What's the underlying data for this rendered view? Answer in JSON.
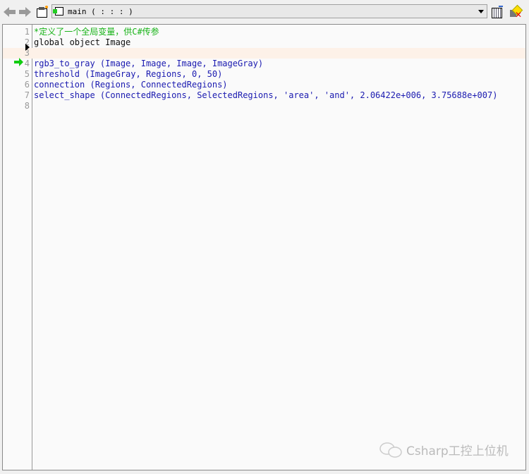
{
  "toolbar": {
    "icons": [
      "back-arrow-icon",
      "forward-arrow-icon",
      "procedure-clipboard-icon",
      "procedure-calendar-icon",
      "delete-procedure-icon"
    ],
    "procedure_select": {
      "value": "main ( : : : )"
    }
  },
  "editor": {
    "lines": [
      {
        "number": "1",
        "text": "*定义了一个全局变量，供C#传参",
        "color": "#18b318"
      },
      {
        "number": "2",
        "text": "global object Image",
        "color": "#111111"
      },
      {
        "number": "3",
        "text": "",
        "highlighted": true
      },
      {
        "number": "4",
        "text": "rgb3_to_gray (Image, Image, Image, ImageGray)",
        "color": "#1a1ab0",
        "program_counter": true
      },
      {
        "number": "5",
        "text": "threshold (ImageGray, Regions, 0, 50)",
        "color": "#1a1ab0"
      },
      {
        "number": "6",
        "text": "connection (Regions, ConnectedRegions)",
        "color": "#1a1ab0"
      },
      {
        "number": "7",
        "text": "select_shape (ConnectedRegions, SelectedRegions, 'area', 'and', 2.06422e+006, 3.75688e+007)",
        "color": "#1a1ab0"
      },
      {
        "number": "8",
        "text": ""
      }
    ]
  },
  "watermark": {
    "text": "Csharp工控上位机"
  }
}
